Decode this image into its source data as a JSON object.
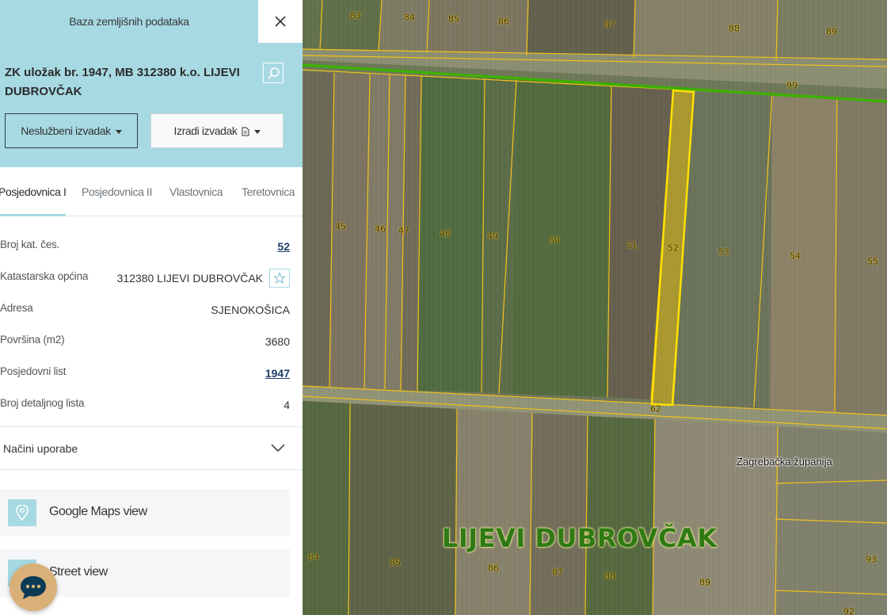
{
  "sidebar": {
    "top_title": "Baza zemljišnih podataka",
    "record_title": "ZK uložak br. 1947, MB 312380 k.o. LIJEVI DUBROVČAK",
    "buttons": {
      "nesluzbeni": "Neslužbeni izvadak",
      "izradi": "Izradi izvadak"
    },
    "tabs": [
      {
        "label": "Posjedovnica I",
        "active": true
      },
      {
        "label": "Posjedovnica II",
        "active": false
      },
      {
        "label": "Vlastovnica",
        "active": false
      },
      {
        "label": "Teretovnica",
        "active": false
      }
    ],
    "properties": [
      {
        "label": "Broj kat. čes.",
        "value": "52",
        "link": true
      },
      {
        "label": "Katastarska općina",
        "value": "312380 LIJEVI DUBROVČAK",
        "link": false
      },
      {
        "label": "Adresa",
        "value": "SJENOKOŠICA",
        "link": false
      },
      {
        "label": "Površina (m2)",
        "value": "3680",
        "link": false
      },
      {
        "label": "Posjedovni list",
        "value": "1947",
        "link": true
      },
      {
        "label": "Broj detaljnog lista",
        "value": "4",
        "link": false
      }
    ],
    "nacini_uporabe": "Načini uporabe",
    "views": {
      "google_maps": "Google Maps view",
      "street": "Street view"
    }
  },
  "map": {
    "region_label": "Zagrebačka županija",
    "place_label": "LIJEVI DUBROVČAK",
    "parcel_numbers": [
      "83",
      "84",
      "85",
      "86",
      "87",
      "88",
      "89",
      "99",
      "45",
      "46",
      "47",
      "48",
      "49",
      "50",
      "51",
      "52",
      "53",
      "54",
      "55",
      "62",
      "84",
      "85",
      "86",
      "87",
      "88",
      "89",
      "93",
      "92"
    ],
    "selected_parcel": "52",
    "colors": {
      "parcel_line": "#f2c21a",
      "selected": "#ffe000",
      "road_highlight": "#3cb000"
    }
  },
  "colors": {
    "accent": "#a7d9e3",
    "link": "#1d3f66",
    "chat": "#d9b077"
  }
}
